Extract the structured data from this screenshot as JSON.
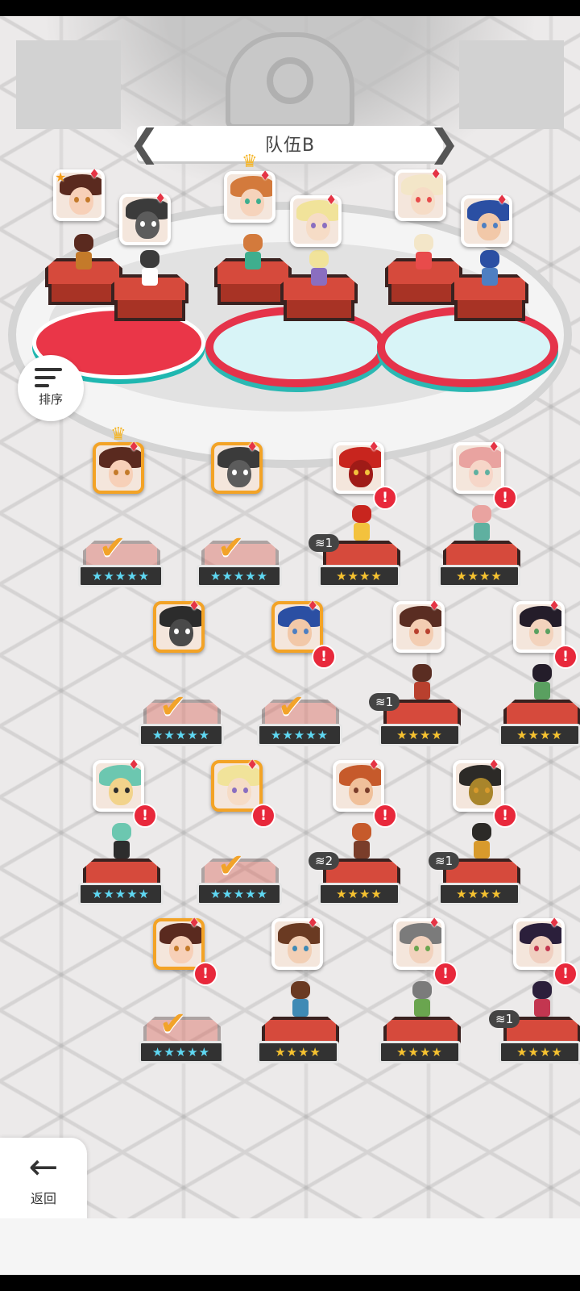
{
  "header": {
    "team_title": "队伍B",
    "prev_label": "❮",
    "next_label": "❯"
  },
  "controls": {
    "sort_label": "排序",
    "back_label": "返回",
    "back_glyph": "←"
  },
  "team_slots": [
    {
      "leader_has_star": true,
      "members": [
        "brunette-girl",
        "grey-wolf"
      ]
    },
    {
      "leader_crowned": true,
      "members": [
        "orange-hair-girl",
        "blonde-girl"
      ]
    },
    {
      "members": [
        "blonde-cap-girl",
        "blue-hair-glasses"
      ]
    }
  ],
  "roster": [
    {
      "id": "c1",
      "stars": "★★★★★",
      "rarity": 5,
      "selected": true,
      "crowned": true,
      "alert": false,
      "dup": ""
    },
    {
      "id": "c2",
      "stars": "★★★★★",
      "rarity": 5,
      "selected": true,
      "crowned": false,
      "alert": false,
      "dup": ""
    },
    {
      "id": "c3",
      "stars": "★★★★",
      "rarity": 4,
      "selected": false,
      "alert": true,
      "dup": "1"
    },
    {
      "id": "c4",
      "stars": "★★★★",
      "rarity": 4,
      "selected": false,
      "alert": true,
      "dup": ""
    },
    {
      "id": "c5",
      "stars": "★★★★★",
      "rarity": 5,
      "selected": true,
      "alert": false,
      "dup": ""
    },
    {
      "id": "c6",
      "stars": "★★★★★",
      "rarity": 5,
      "selected": true,
      "alert": true,
      "dup": ""
    },
    {
      "id": "c7",
      "stars": "★★★★",
      "rarity": 4,
      "selected": false,
      "alert": false,
      "dup": "1"
    },
    {
      "id": "c8",
      "stars": "★★★★",
      "rarity": 4,
      "selected": false,
      "alert": true,
      "dup": ""
    },
    {
      "id": "c9",
      "stars": "★★★★★",
      "rarity": 5,
      "selected": false,
      "alert": true,
      "dup": ""
    },
    {
      "id": "c10",
      "stars": "★★★★★",
      "rarity": 5,
      "selected": true,
      "alert": true,
      "dup": ""
    },
    {
      "id": "c11",
      "stars": "★★★★",
      "rarity": 4,
      "selected": false,
      "alert": true,
      "dup": "2"
    },
    {
      "id": "c12",
      "stars": "★★★★",
      "rarity": 4,
      "selected": false,
      "alert": true,
      "dup": "1"
    },
    {
      "id": "c13",
      "stars": "★★★★★",
      "rarity": 5,
      "selected": true,
      "alert": true,
      "dup": ""
    },
    {
      "id": "c14",
      "stars": "★★★★",
      "rarity": 4,
      "selected": false,
      "alert": false,
      "dup": ""
    },
    {
      "id": "c15",
      "stars": "★★★★",
      "rarity": 4,
      "selected": false,
      "alert": true,
      "dup": ""
    },
    {
      "id": "c16",
      "stars": "★★★★",
      "rarity": 4,
      "selected": false,
      "alert": true,
      "dup": "1"
    }
  ],
  "symbols": {
    "suit": "♦",
    "check": "✔",
    "alert": "!",
    "crown": "♛",
    "badge_star": "★",
    "dup_icon": "≋"
  },
  "colors": {
    "selected_border": "#f3a326",
    "alert": "#e8283b",
    "pedestal": "#d64a3c",
    "slot_red": "#ea3648",
    "slot_blue": "#d8f4f7"
  }
}
